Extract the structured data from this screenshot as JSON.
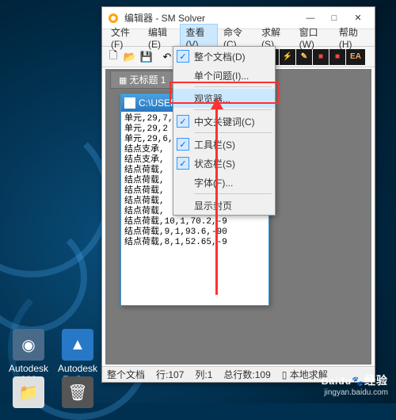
{
  "desktop": {
    "icons": [
      {
        "label": "Autodesk 360",
        "glyph": "◉"
      },
      {
        "label": "Autodesk ReCap",
        "glyph": "▲"
      },
      {
        "label": "",
        "glyph": "📁"
      },
      {
        "label": "",
        "glyph": "🗑"
      }
    ]
  },
  "window": {
    "title": "编辑器 - SM Solver",
    "winbtns": {
      "min": "—",
      "max": "□",
      "close": "✕"
    },
    "menu": [
      "文件(F)",
      "编辑(E)",
      "查看(V)",
      "命令(C)",
      "求解(S)",
      "窗口(W)",
      "帮助(H)"
    ],
    "toolbar_glyphs": [
      "🗋",
      "📂",
      "💾",
      "",
      "↶",
      "↷",
      "✂",
      "📋",
      "📄",
      "",
      "■",
      "■",
      "⚡",
      "✎",
      "■",
      "■",
      "EA"
    ],
    "tab_label": "无标题 1",
    "status": {
      "scope": "整个文档",
      "line": "行:107",
      "col": "列:1",
      "total": "总行数:109",
      "mode": "本地求解"
    }
  },
  "dropdown": {
    "items": [
      {
        "label": "整个文档(D)",
        "check": true
      },
      {
        "label": "单个问题(I)...",
        "check": false
      },
      {
        "label": "观览器...",
        "check": false,
        "hl": true
      },
      {
        "label": "中文关键词(C)",
        "check": true
      },
      {
        "label": "工具栏(S)",
        "check": true
      },
      {
        "label": "状态栏(S)",
        "check": true
      },
      {
        "label": "字体(F)...",
        "check": false
      },
      {
        "label": "显示封页",
        "check": false
      }
    ]
  },
  "subwindow": {
    "title": "C:\\USER...",
    "close": "✕",
    "text": "单元,29,7,\n单元,29,2\n单元,29,6,\n结点支承,\n结点支承,\n结点荷载,\n结点荷载,\n结点荷载,\n结点荷载,\n结点荷载,\n结点荷载,10,1,70.2,-9\n结点荷载,9,1,93.6,-90\n结点荷载,8,1,52.65,-9"
  },
  "watermark": {
    "brand": "Baidu",
    "sub": "经验",
    "url": "jingyan.baidu.com",
    "paw": "🐾"
  }
}
